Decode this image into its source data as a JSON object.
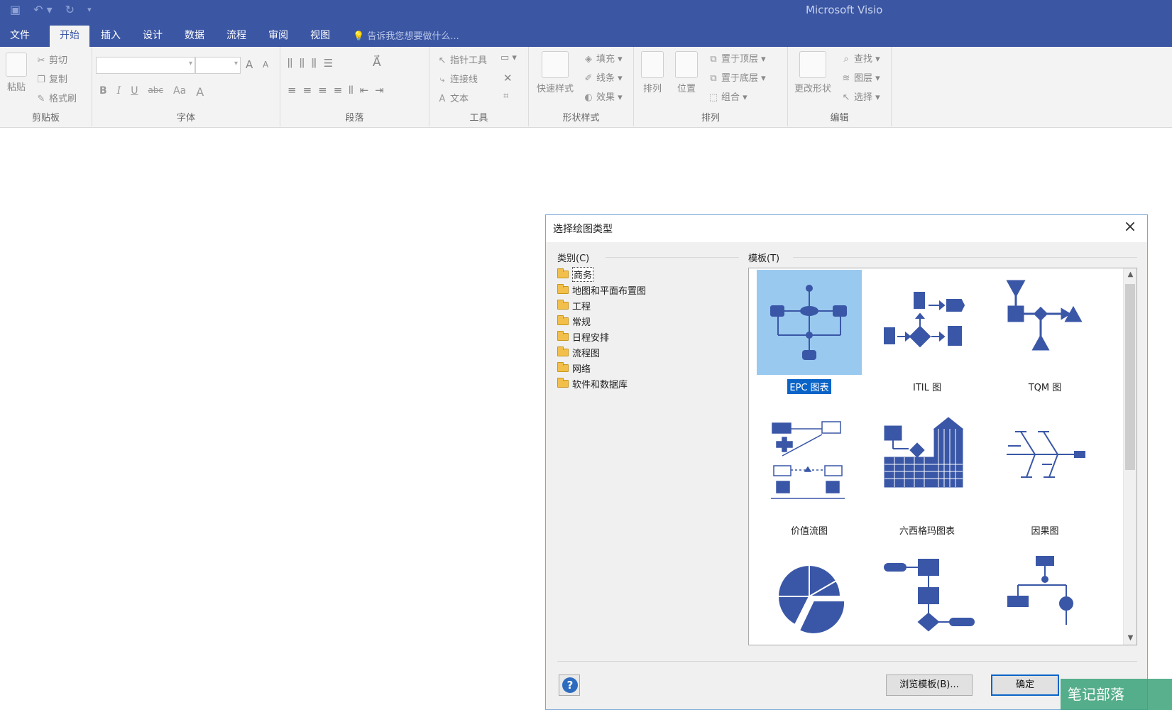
{
  "titlebar": {
    "app_title": "Microsoft Visio"
  },
  "qat": {
    "save_icon": "save-icon",
    "undo_icon": "undo-icon",
    "redo_icon": "redo-icon",
    "customize_icon": "customize-qat-icon"
  },
  "tabs": [
    {
      "label": "文件"
    },
    {
      "label": "开始"
    },
    {
      "label": "插入"
    },
    {
      "label": "设计"
    },
    {
      "label": "数据"
    },
    {
      "label": "流程"
    },
    {
      "label": "审阅"
    },
    {
      "label": "视图"
    }
  ],
  "tellme": "告诉我您想要做什么...",
  "ribbon": {
    "clipboard": {
      "paste": "粘贴",
      "cut": "剪切",
      "copy": "复制",
      "format_painter": "格式刷",
      "label": "剪贴板"
    },
    "font": {
      "bold": "B",
      "italic": "I",
      "underline": "U",
      "strike": "abc",
      "case": "Aa",
      "color": "A",
      "grow": "A",
      "shrink": "A",
      "label": "字体"
    },
    "paragraph": {
      "label": "段落"
    },
    "tools": {
      "pointer": "指针工具",
      "connector": "连接线",
      "text": "文本",
      "label": "工具"
    },
    "shape_styles": {
      "quick_styles": "快速样式",
      "fill": "填充",
      "line": "线条",
      "effects": "效果",
      "label": "形状样式"
    },
    "arrange": {
      "arrange": "排列",
      "position": "位置",
      "bring_front": "置于顶层",
      "send_back": "置于底层",
      "group": "组合",
      "label": "排列"
    },
    "editing": {
      "change_shape": "更改形状",
      "find": "查找",
      "layers": "图层",
      "select": "选择",
      "label": "编辑"
    }
  },
  "dialog": {
    "title": "选择绘图类型",
    "category_label": "类别(C)",
    "template_label": "模板(T)",
    "categories": [
      {
        "label": "商务"
      },
      {
        "label": "地图和平面布置图"
      },
      {
        "label": "工程"
      },
      {
        "label": "常规"
      },
      {
        "label": "日程安排"
      },
      {
        "label": "流程图"
      },
      {
        "label": "网络"
      },
      {
        "label": "软件和数据库"
      }
    ],
    "templates": [
      {
        "label": "EPC 图表"
      },
      {
        "label": "ITIL 图"
      },
      {
        "label": "TQM 图"
      },
      {
        "label": "价值流图"
      },
      {
        "label": "六西格玛图表"
      },
      {
        "label": "因果图"
      },
      {
        "label": ""
      },
      {
        "label": ""
      },
      {
        "label": ""
      }
    ],
    "browse_button": "浏览模板(B)...",
    "ok_button": "确定",
    "help": "?"
  },
  "watermark": "笔记部落",
  "colors": {
    "accent": "#3b56a3",
    "shape_blue": "#3a57a7",
    "selection": "#99c9ef"
  }
}
